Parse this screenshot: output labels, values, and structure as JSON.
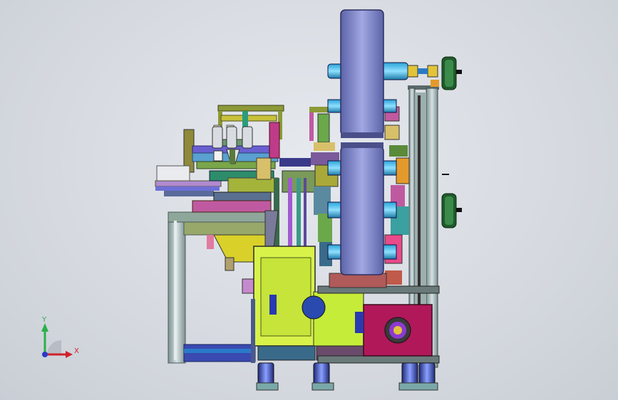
{
  "triad": {
    "y_label": "Y",
    "x_label": "X"
  },
  "colors": {
    "background": "#d7dbe1",
    "drum": "#7f86c9",
    "frame": "#9fb2b4",
    "motor_box": "#b0185a",
    "yellow_base": "#d8f24a"
  }
}
